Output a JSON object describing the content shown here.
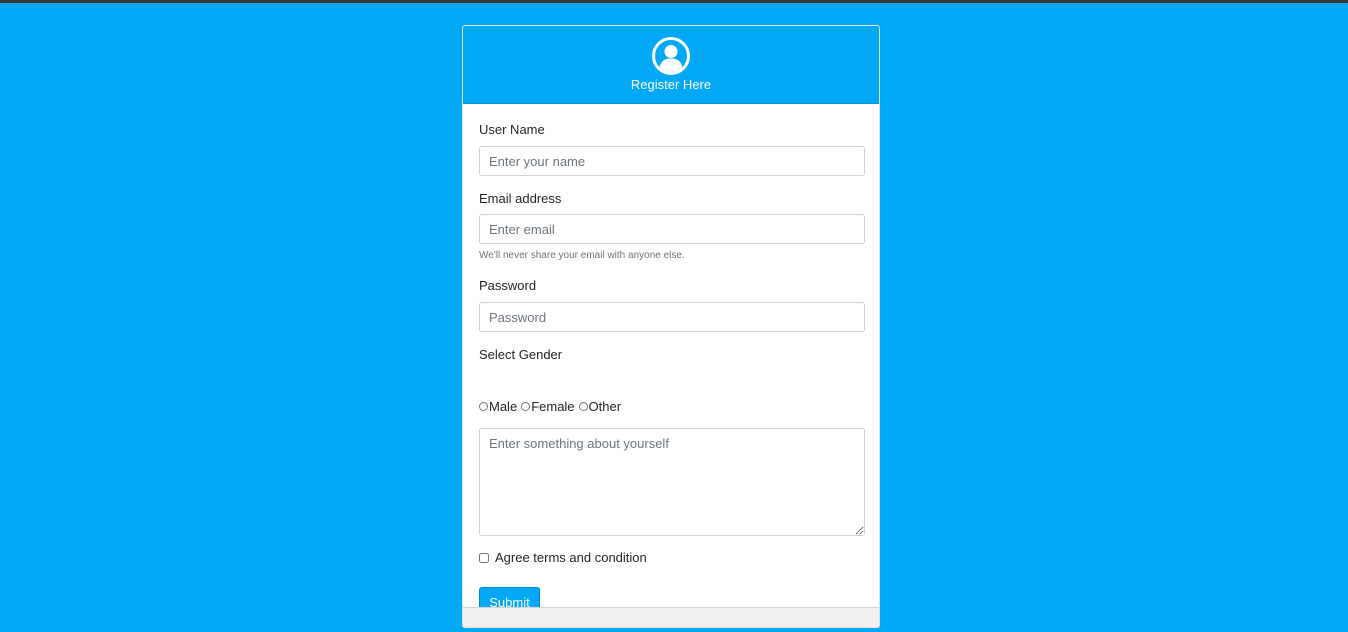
{
  "form": {
    "header_title": "Register Here",
    "username": {
      "label": "User Name",
      "placeholder": "Enter your name"
    },
    "email": {
      "label": "Email address",
      "placeholder": "Enter email",
      "help": "We'll never share your email with anyone else."
    },
    "password": {
      "label": "Password",
      "placeholder": "Password"
    },
    "gender": {
      "label": "Select Gender",
      "options": [
        "Male",
        "Female",
        "Other"
      ]
    },
    "about": {
      "placeholder": "Enter something about yourself"
    },
    "terms_label": "Agree terms and condition",
    "submit_label": "Submit"
  },
  "colors": {
    "page_background": "#03a9f4",
    "header_background": "#03a9f4",
    "button_background": "#03a9f4",
    "text": "#212529",
    "muted_text": "#6c757d"
  },
  "icons": {
    "header_icon": "user-circle-icon"
  }
}
